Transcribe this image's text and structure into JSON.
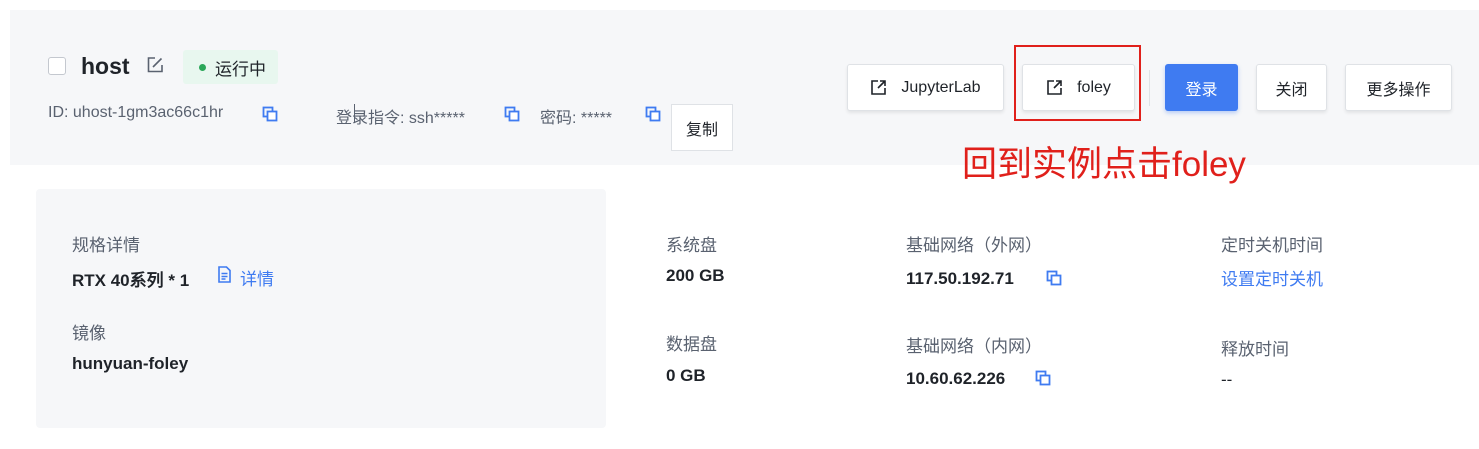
{
  "header": {
    "host_name": "host",
    "status": "运行中",
    "id_text": "ID: uhost-1gm3ac66c1hr",
    "login_cmd": "登录指令: ssh*****",
    "password": "密码: *****",
    "copy_label": "复制"
  },
  "actions": {
    "jupyterlab": "JupyterLab",
    "foley": "foley",
    "login": "登录",
    "close": "关闭",
    "more": "更多操作"
  },
  "annotation": {
    "text": "回到实例点击foley"
  },
  "details": {
    "spec_label": "规格详情",
    "spec_value": "RTX 40系列 * 1",
    "spec_link": "详情",
    "image_label": "镜像",
    "image_value": "hunyuan-foley",
    "system_disk_label": "系统盘",
    "system_disk_value": "200 GB",
    "data_disk_label": "数据盘",
    "data_disk_value": "0 GB",
    "public_net_label": "基础网络（外网）",
    "public_net_value": "117.50.192.71",
    "private_net_label": "基础网络（内网）",
    "private_net_value": "10.60.62.226",
    "shutdown_label": "定时关机时间",
    "shutdown_link": "设置定时关机",
    "release_label": "释放时间",
    "release_value": "--"
  },
  "colors": {
    "primary": "#3f7bf1",
    "status_green": "#2aa758",
    "annotation_red": "#e0201b"
  },
  "icons": {
    "edit": "edit-icon",
    "copy": "copy-icon",
    "external": "external-link-icon",
    "document": "document-icon"
  }
}
